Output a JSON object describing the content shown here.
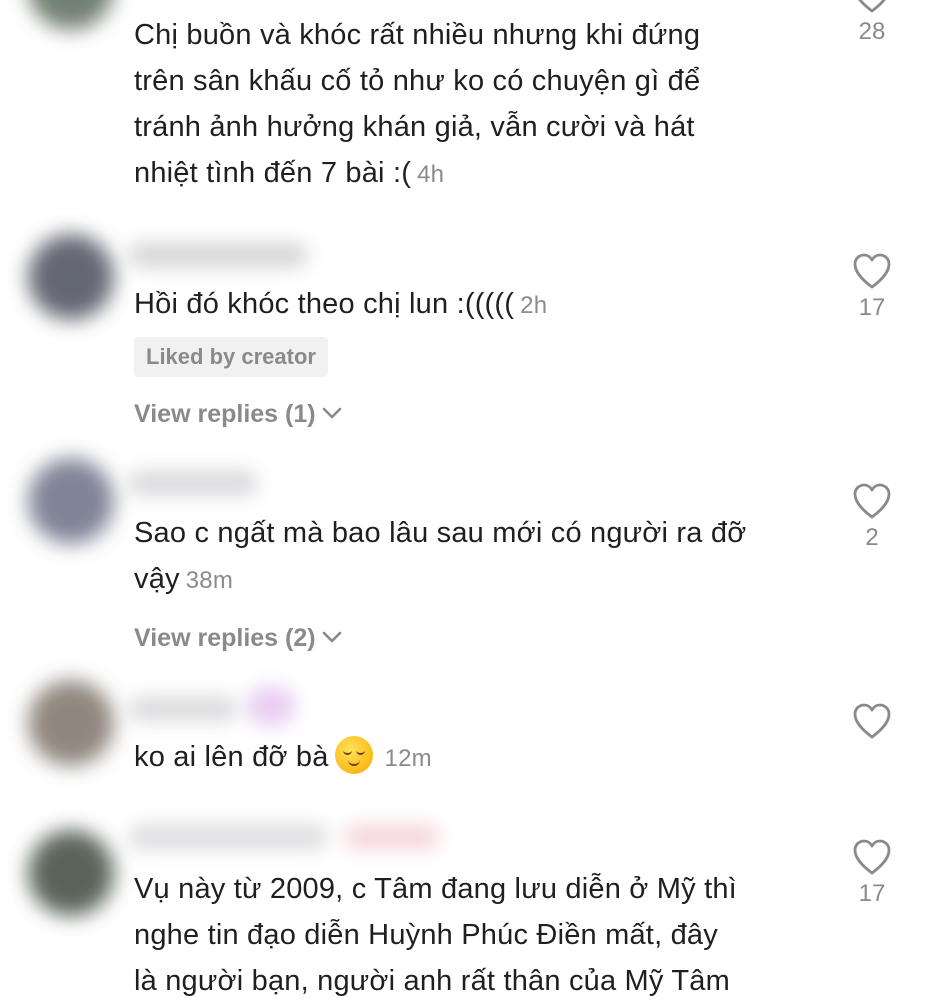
{
  "comments": [
    {
      "text_lines": [
        "Chị buồn và khóc rất nhiều nhưng khi đứng",
        "trên sân khấu cố tỏ như ko có chuyện gì để",
        "tránh ảnh hưởng khán giả, vẫn cười và hát",
        "nhiệt tình đến 7 bài :("
      ],
      "time": "4h",
      "likes": "28",
      "avatar_color": "#5a6a5a"
    },
    {
      "text": "Hồi đó khóc theo chị lun :(((((",
      "time": "2h",
      "badge": "Liked by creator",
      "replies": "View replies (1)",
      "likes": "17",
      "avatar_color": "#4a4e5c"
    },
    {
      "text_lines": [
        "Sao c ngất mà bao lâu sau mới có người ra đỡ",
        "vậy"
      ],
      "time": "38m",
      "replies": "View replies (2)",
      "likes": "2",
      "avatar_color": "#6a6f85"
    },
    {
      "text": "ko ai lên đỡ bà",
      "emoji": "relieved-face",
      "time": "12m",
      "likes": "",
      "avatar_color": "#7d7268"
    },
    {
      "text_lines": [
        "Vụ này từ 2009, c Tâm đang lưu diễn ở Mỹ thì",
        "nghe tin đạo diễn Huỳnh Phúc Điền mất, đây",
        "là người bạn, người anh rất thân của Mỹ Tâm"
      ],
      "likes": "17",
      "avatar_color": "#3d4a3d"
    }
  ],
  "colors": {
    "text": "#1f1f1f",
    "secondary": "#8a8a8a",
    "badge_bg": "#f1f1f2"
  }
}
